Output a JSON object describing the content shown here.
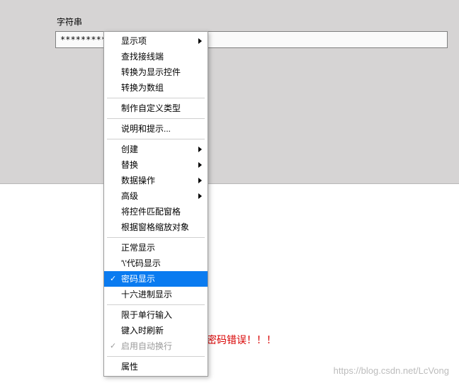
{
  "panel": {
    "label": "字符串",
    "input_value": "**************"
  },
  "error_message": "密码错误！！！",
  "watermark": "https://blog.csdn.net/LcVong",
  "menu": {
    "items": [
      {
        "label": "显示项",
        "submenu": true
      },
      {
        "label": "查找接线端"
      },
      {
        "label": "转换为显示控件"
      },
      {
        "label": "转换为数组"
      },
      {
        "sep": true
      },
      {
        "label": "制作自定义类型"
      },
      {
        "sep": true
      },
      {
        "label": "说明和提示..."
      },
      {
        "sep": true
      },
      {
        "label": "创建",
        "submenu": true
      },
      {
        "label": "替换",
        "submenu": true
      },
      {
        "label": "数据操作",
        "submenu": true
      },
      {
        "label": "高级",
        "submenu": true
      },
      {
        "label": "将控件匹配窗格"
      },
      {
        "label": "根据窗格缩放对象"
      },
      {
        "sep": true
      },
      {
        "label": "正常显示"
      },
      {
        "label": "'\\'代码显示"
      },
      {
        "label": "密码显示",
        "checked": true,
        "selected": true
      },
      {
        "label": "十六进制显示"
      },
      {
        "sep": true
      },
      {
        "label": "限于单行输入"
      },
      {
        "label": "键入时刷新"
      },
      {
        "label": "启用自动换行",
        "checked": true,
        "disabled": true
      },
      {
        "sep": true
      },
      {
        "label": "属性"
      }
    ]
  }
}
